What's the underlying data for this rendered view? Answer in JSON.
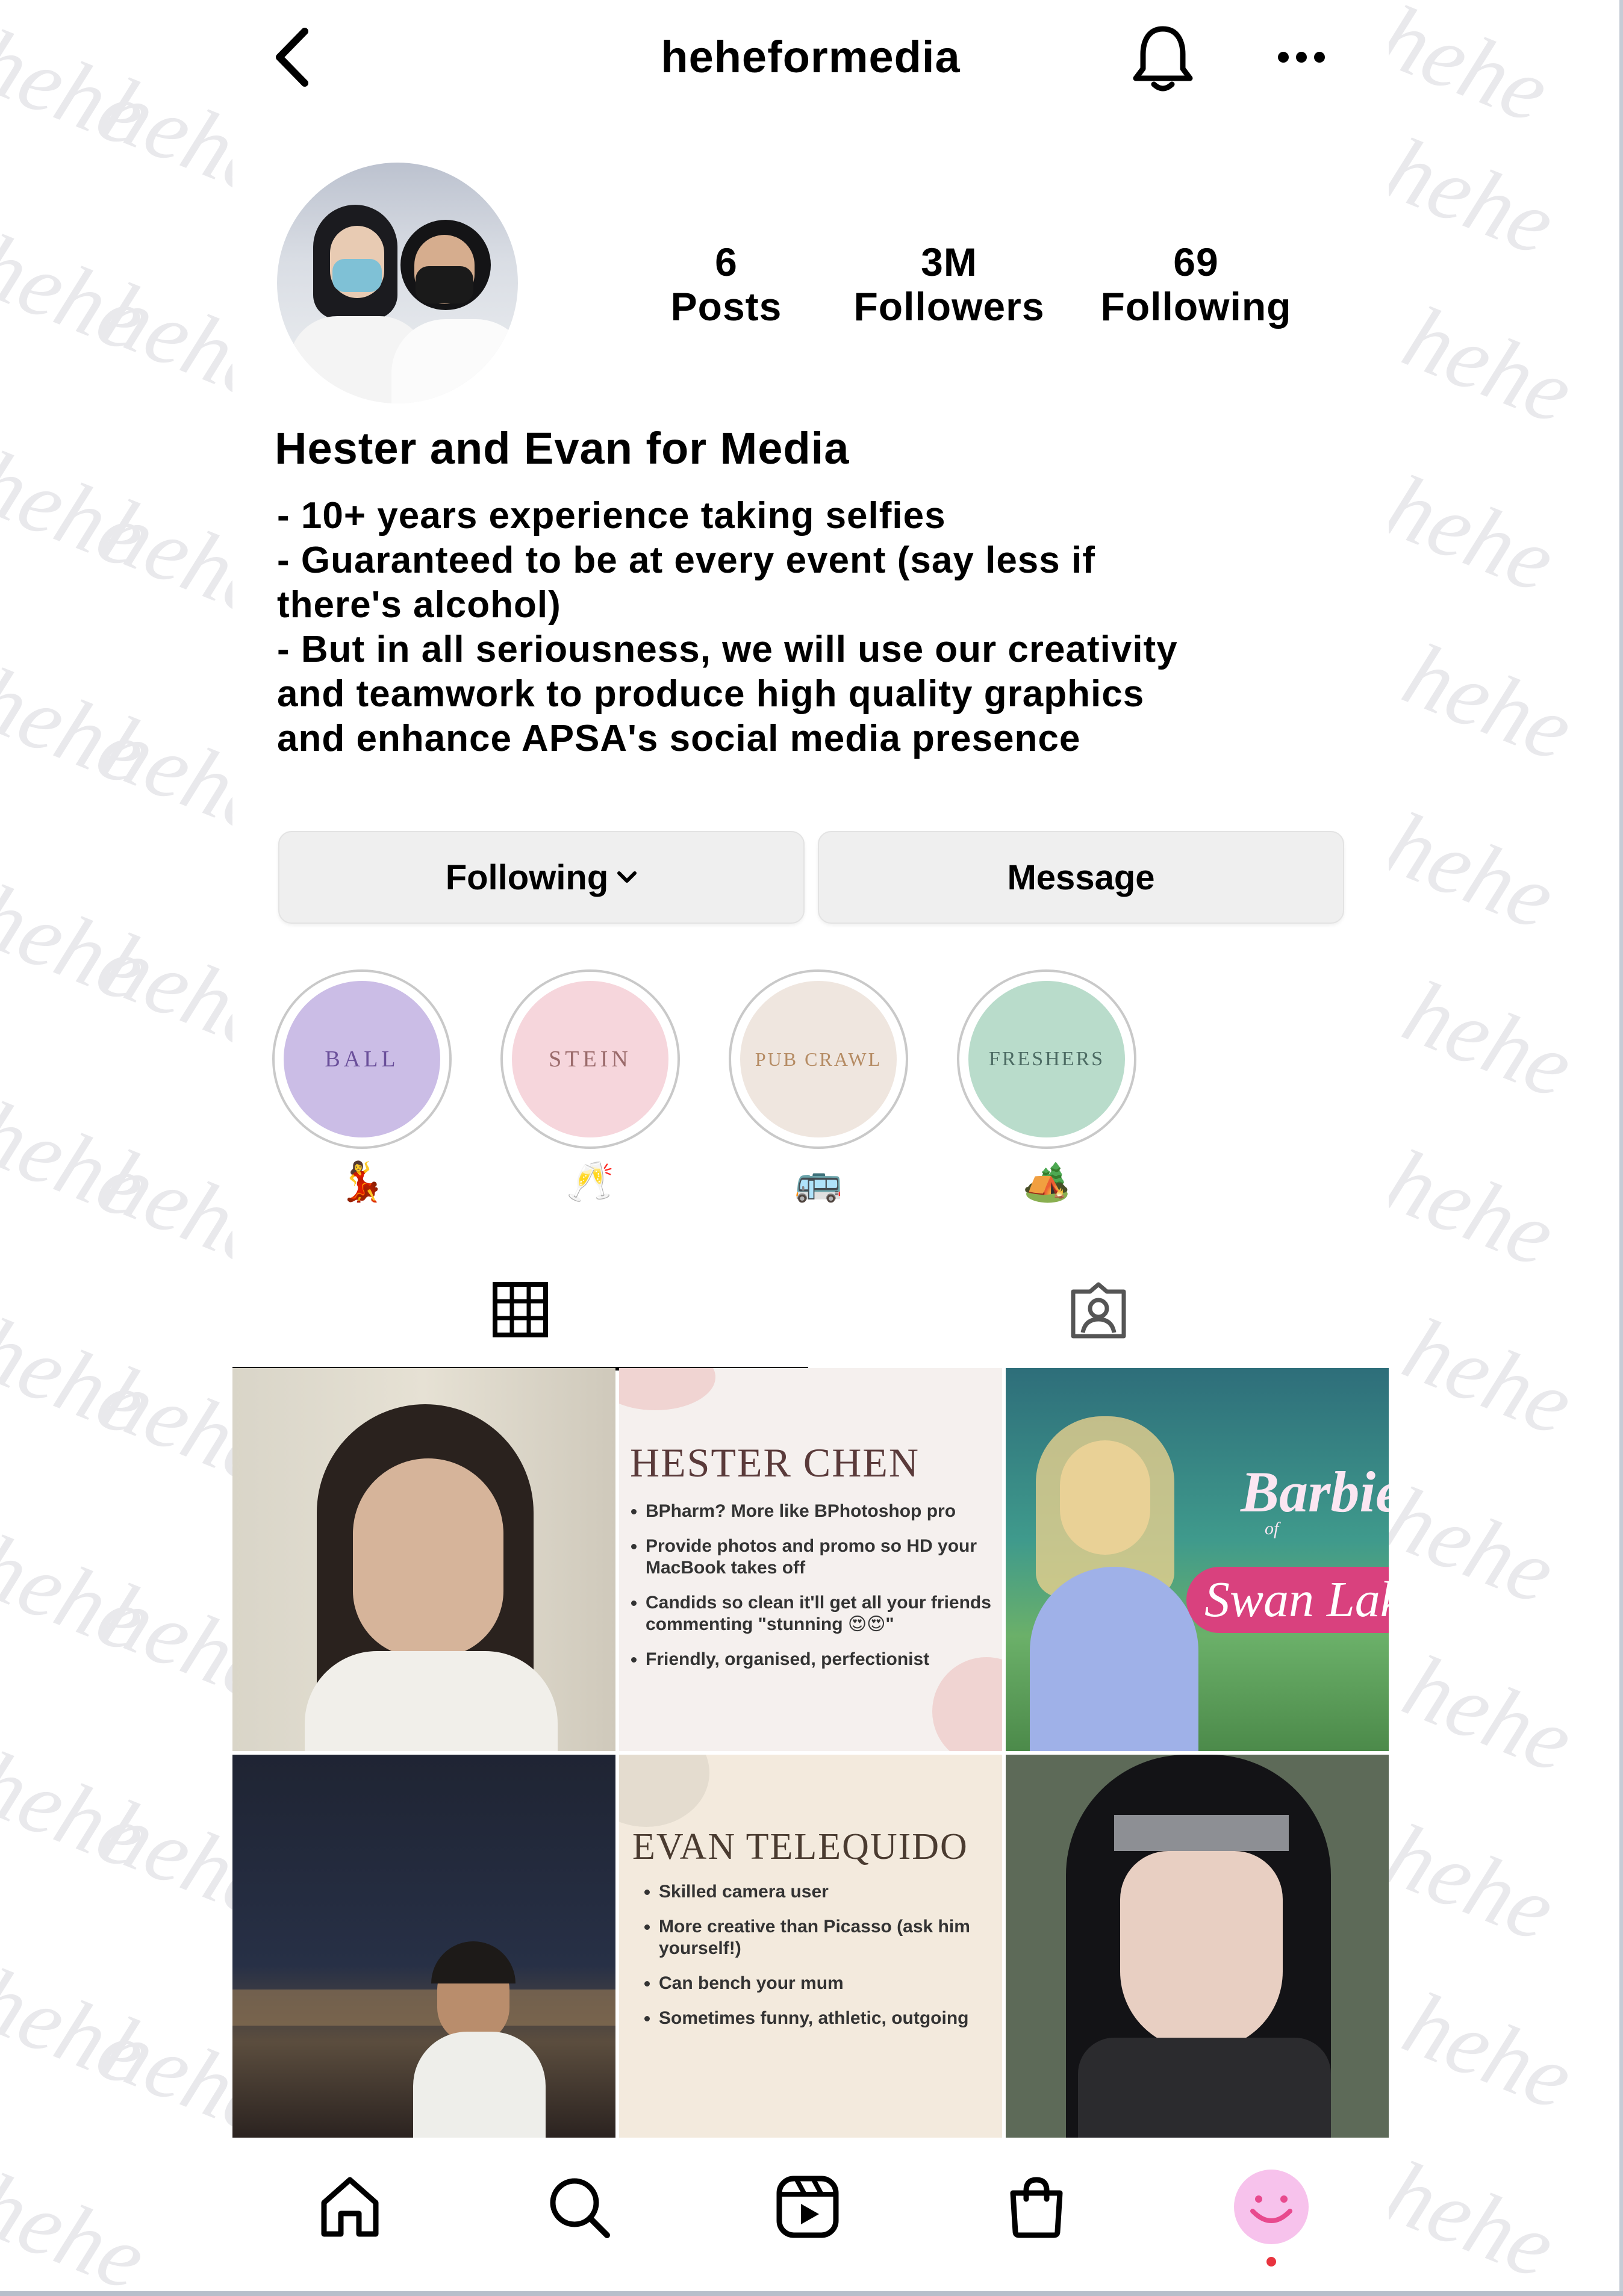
{
  "watermark": "hehe",
  "header": {
    "username": "heheformedia",
    "icons": [
      "back-arrow-icon",
      "bell-icon",
      "more-icon"
    ]
  },
  "profile": {
    "stats": {
      "posts": {
        "value": "6",
        "label": "Posts"
      },
      "followers": {
        "value": "3M",
        "label": "Followers"
      },
      "following": {
        "value": "69",
        "label": "Following"
      }
    },
    "name": "Hester and Evan for Media",
    "bio": [
      "- 10+ years experience taking selfies",
      "- Guaranteed to be at every event (say less if",
      "there's alcohol)",
      "- But in all seriousness, we will use our creativity",
      "and teamwork to produce high quality graphics",
      "and enhance APSA's social media presence"
    ]
  },
  "actions": {
    "following_label": "Following",
    "message_label": "Message"
  },
  "highlights": [
    {
      "title": "BALL",
      "emoji": "💃",
      "color": "#cbbde6",
      "text_color": "#6a4f9a"
    },
    {
      "title": "STEIN",
      "emoji": "🥂",
      "color": "#f6d6dc",
      "text_color": "#9a6a6a"
    },
    {
      "title": "PUB CRAWL",
      "emoji": "🚌",
      "color": "#efe6df",
      "text_color": "#b58b63"
    },
    {
      "title": "FRESHERS",
      "emoji": "🏕️",
      "color": "#b9dccb",
      "text_color": "#4c6b63"
    }
  ],
  "tabs": [
    "grid-icon",
    "tagged-icon"
  ],
  "posts": {
    "hester_card": {
      "title": "HESTER CHEN",
      "items": [
        "BPharm? More like BPhotoshop pro",
        "Provide photos and promo so HD your MacBook takes off",
        "Candids so clean it'll get all your friends commenting \"stunning 😍😍\"",
        "Friendly, organised, perfectionist"
      ]
    },
    "barbie": {
      "title": "Barbie",
      "subtitle": "of",
      "subtitle2": "Swan Lake"
    },
    "evan_card": {
      "title": "EVAN TELEQUIDO",
      "items": [
        "Skilled camera user",
        "More creative than Picasso (ask him yourself!)",
        "Can bench your mum",
        "Sometimes funny, athletic, outgoing"
      ]
    }
  },
  "nav": [
    "home-icon",
    "search-icon",
    "reels-icon",
    "shop-icon",
    "profile-avatar"
  ]
}
